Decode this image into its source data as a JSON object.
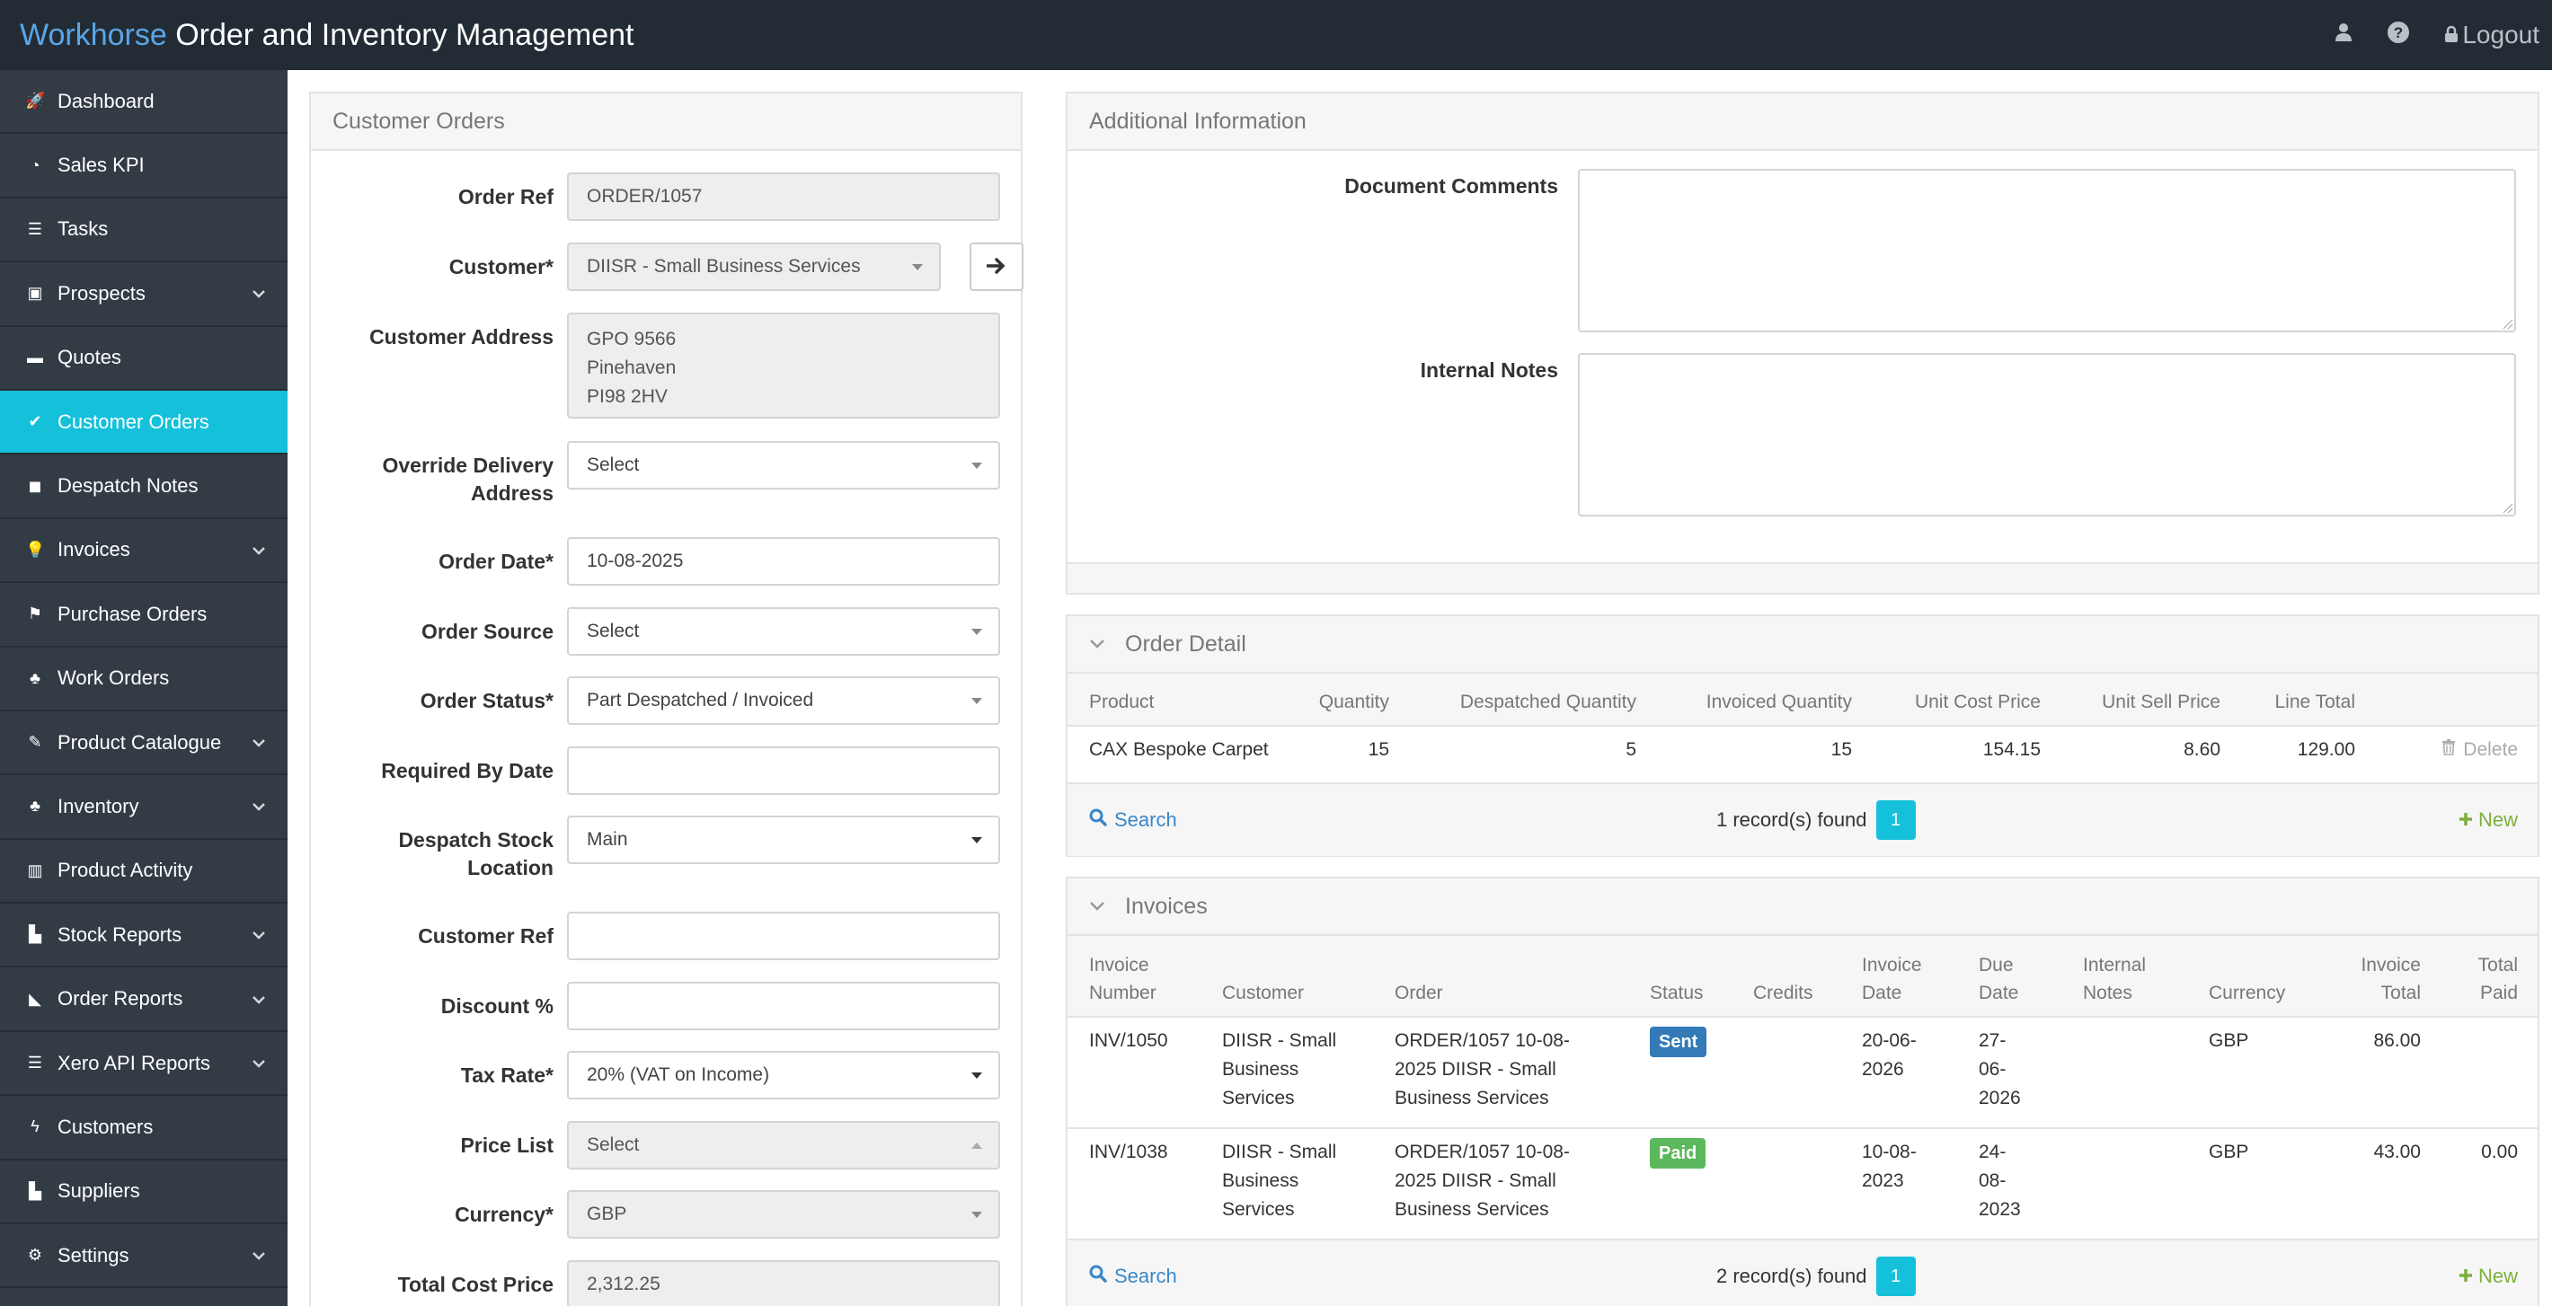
{
  "header": {
    "brand_name": "Workhorse",
    "title": "Order and Inventory Management",
    "logout_label": "Logout",
    "user_icon": "user-icon",
    "help_icon": "help-icon",
    "lock_icon": "lock-icon"
  },
  "sidebar": {
    "items": [
      {
        "label": "Dashboard",
        "icon": "rocket-icon",
        "glyph": "🚀",
        "chevron": false
      },
      {
        "label": "Sales KPI",
        "icon": "pie-chart-icon",
        "glyph": "◔",
        "chevron": false
      },
      {
        "label": "Tasks",
        "icon": "list-icon",
        "glyph": "☰",
        "chevron": false
      },
      {
        "label": "Prospects",
        "icon": "bus-icon",
        "glyph": "▣",
        "chevron": true
      },
      {
        "label": "Quotes",
        "icon": "briefcase-icon",
        "glyph": "▬",
        "chevron": false
      },
      {
        "label": "Customer Orders",
        "icon": "check-circle-icon",
        "glyph": "✔",
        "chevron": false,
        "active": true
      },
      {
        "label": "Despatch Notes",
        "icon": "truck-icon",
        "glyph": "◼",
        "chevron": false
      },
      {
        "label": "Invoices",
        "icon": "lightbulb-icon",
        "glyph": "💡",
        "chevron": true
      },
      {
        "label": "Purchase Orders",
        "icon": "flag-icon",
        "glyph": "⚑",
        "chevron": false
      },
      {
        "label": "Work Orders",
        "icon": "tree-icon",
        "glyph": "♣",
        "chevron": false
      },
      {
        "label": "Product Catalogue",
        "icon": "leaf-icon",
        "glyph": "✎",
        "chevron": true
      },
      {
        "label": "Inventory",
        "icon": "tree-icon",
        "glyph": "♣",
        "chevron": true
      },
      {
        "label": "Product Activity",
        "icon": "barcode-icon",
        "glyph": "▥",
        "chevron": false
      },
      {
        "label": "Stock Reports",
        "icon": "bar-chart-icon",
        "glyph": "▙",
        "chevron": true
      },
      {
        "label": "Order Reports",
        "icon": "area-chart-icon",
        "glyph": "◣",
        "chevron": true
      },
      {
        "label": "Xero API Reports",
        "icon": "list-icon",
        "glyph": "☰",
        "chevron": true
      },
      {
        "label": "Customers",
        "icon": "bolt-icon",
        "glyph": "ϟ",
        "chevron": false
      },
      {
        "label": "Suppliers",
        "icon": "bar-chart-icon",
        "glyph": "▙",
        "chevron": false
      },
      {
        "label": "Settings",
        "icon": "gear-icon",
        "glyph": "⚙",
        "chevron": true
      }
    ]
  },
  "customer_orders": {
    "title": "Customer Orders",
    "order_ref_label": "Order Ref",
    "order_ref_value": "ORDER/1057",
    "customer_label": "Customer*",
    "customer_value": "DIISR - Small Business Services",
    "customer_address_label": "Customer Address",
    "customer_address_lines": [
      "GPO 9566",
      "Pinehaven",
      "PI98 2HV"
    ],
    "override_delivery_label_1": "Override Delivery",
    "override_delivery_label_2": "Address",
    "override_delivery_value": "Select",
    "order_date_label": "Order Date*",
    "order_date_value": "10-08-2025",
    "order_source_label": "Order Source",
    "order_source_value": "Select",
    "order_status_label": "Order Status*",
    "order_status_value": "Part Despatched / Invoiced",
    "required_by_label": "Required By Date",
    "required_by_value": "",
    "despatch_stock_label_1": "Despatch Stock",
    "despatch_stock_label_2": "Location",
    "despatch_stock_value": "Main",
    "customer_ref_label": "Customer Ref",
    "customer_ref_value": "",
    "discount_label": "Discount %",
    "discount_value": "",
    "tax_rate_label": "Tax Rate*",
    "tax_rate_value": "20% (VAT on Income)",
    "price_list_label": "Price List",
    "price_list_value": "Select",
    "currency_label": "Currency*",
    "currency_value": "GBP",
    "total_cost_label": "Total Cost Price",
    "total_cost_value": "2,312.25"
  },
  "additional_info": {
    "title": "Additional Information",
    "document_comments_label": "Document Comments",
    "internal_notes_label": "Internal Notes"
  },
  "order_detail": {
    "title": "Order Detail",
    "columns": [
      "Product",
      "Quantity",
      "Despatched Quantity",
      "Invoiced Quantity",
      "Unit Cost Price",
      "Unit Sell Price",
      "Line Total"
    ],
    "rows": [
      {
        "product": "CAX Bespoke Carpet",
        "quantity": "15",
        "despatched": "5",
        "invoiced": "15",
        "unit_cost": "154.15",
        "unit_sell": "8.60",
        "line_total": "129.00",
        "delete": "Delete"
      }
    ],
    "search_label": "Search",
    "records_text": "1 record(s) found",
    "page": "1",
    "new_label": "New"
  },
  "invoices": {
    "title": "Invoices",
    "columns": {
      "number_1": "Invoice",
      "number_2": "Number",
      "customer": "Customer",
      "order": "Order",
      "status": "Status",
      "credits": "Credits",
      "date_1": "Invoice",
      "date_2": "Date",
      "due_1": "Due",
      "due_2": "Date",
      "notes_1": "Internal",
      "notes_2": "Notes",
      "currency": "Currency",
      "total_1": "Invoice",
      "total_2": "Total",
      "paid_1": "Total",
      "paid_2": "Paid"
    },
    "rows": [
      {
        "number": "INV/1050",
        "customer": [
          "DIISR - Small",
          "Business",
          "Services"
        ],
        "order": [
          "ORDER/1057 10-08-",
          "2025 DIISR - Small",
          "Business Services"
        ],
        "status": "Sent",
        "status_color": "#337ab7",
        "credits": "",
        "date": [
          "20-06-",
          "2026"
        ],
        "due": [
          "27-",
          "06-",
          "2026"
        ],
        "notes": "",
        "currency": "GBP",
        "total": "86.00",
        "paid": ""
      },
      {
        "number": "INV/1038",
        "customer": [
          "DIISR - Small",
          "Business",
          "Services"
        ],
        "order": [
          "ORDER/1057 10-08-",
          "2025 DIISR - Small",
          "Business Services"
        ],
        "status": "Paid",
        "status_color": "#5cb85c",
        "credits": "",
        "date": [
          "10-08-",
          "2023"
        ],
        "due": [
          "24-",
          "08-",
          "2023"
        ],
        "notes": "",
        "currency": "GBP",
        "total": "43.00",
        "paid": "0.00"
      }
    ],
    "search_label": "Search",
    "records_text": "2 record(s) found",
    "page": "1",
    "new_label": "New"
  },
  "colors": {
    "topbar": "#232c35",
    "sidebar": "#333c45",
    "accent": "#15c0db",
    "brand": "#5aa6e8",
    "new_link": "#7cb13c",
    "search_link": "#3a87c7"
  }
}
